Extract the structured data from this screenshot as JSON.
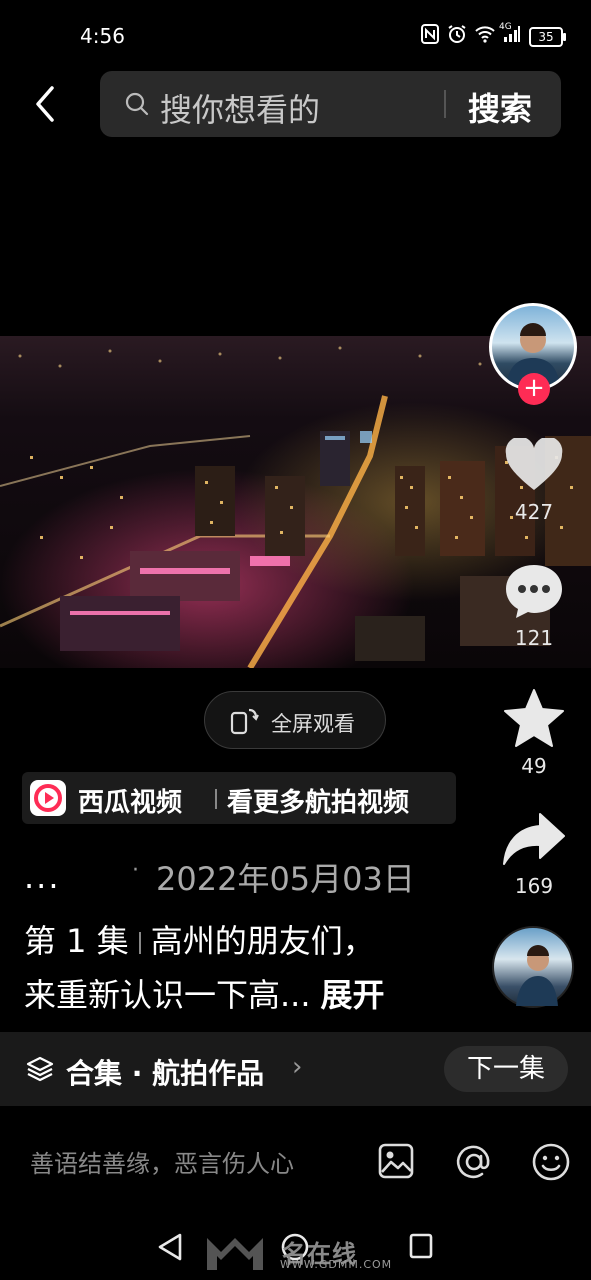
{
  "status_bar": {
    "time": "4:56",
    "network": "4G",
    "battery": "35"
  },
  "search": {
    "placeholder": "搜你想看的",
    "submit_label": "搜索"
  },
  "video": {
    "fullscreen_label": "全屏观看"
  },
  "right_rail": {
    "like_count": "427",
    "comment_count": "121",
    "favorite_count": "49",
    "share_count": "169"
  },
  "xigua_banner": {
    "app_name": "西瓜视频",
    "cta": "看更多航拍视频"
  },
  "post": {
    "author": "...",
    "date": "2022年05月03日",
    "episode": "第 1 集",
    "desc_line1": "高州的朋友们，",
    "desc_line2": "来重新认识一下高...",
    "expand_label": "展开"
  },
  "collection": {
    "title": "合集 · 航拍作品",
    "next_label": "下一集"
  },
  "comment": {
    "placeholder": "善语结善缘，恶言伤人心"
  },
  "watermark": {
    "brand": "名在线",
    "url": "WWW.GDMM.COM"
  },
  "colors": {
    "accent_red": "#fe2c55",
    "background": "#000000"
  }
}
